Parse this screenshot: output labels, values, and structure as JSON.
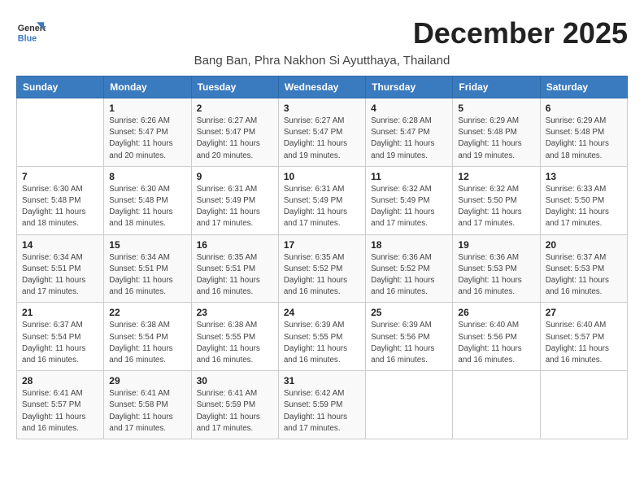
{
  "header": {
    "logo_line1": "General",
    "logo_line2": "Blue",
    "month_title": "December 2025",
    "location": "Bang Ban, Phra Nakhon Si Ayutthaya, Thailand"
  },
  "weekdays": [
    "Sunday",
    "Monday",
    "Tuesday",
    "Wednesday",
    "Thursday",
    "Friday",
    "Saturday"
  ],
  "weeks": [
    [
      {
        "day": "",
        "sunrise": "",
        "sunset": "",
        "daylight": ""
      },
      {
        "day": "1",
        "sunrise": "Sunrise: 6:26 AM",
        "sunset": "Sunset: 5:47 PM",
        "daylight": "Daylight: 11 hours and 20 minutes."
      },
      {
        "day": "2",
        "sunrise": "Sunrise: 6:27 AM",
        "sunset": "Sunset: 5:47 PM",
        "daylight": "Daylight: 11 hours and 20 minutes."
      },
      {
        "day": "3",
        "sunrise": "Sunrise: 6:27 AM",
        "sunset": "Sunset: 5:47 PM",
        "daylight": "Daylight: 11 hours and 19 minutes."
      },
      {
        "day": "4",
        "sunrise": "Sunrise: 6:28 AM",
        "sunset": "Sunset: 5:47 PM",
        "daylight": "Daylight: 11 hours and 19 minutes."
      },
      {
        "day": "5",
        "sunrise": "Sunrise: 6:29 AM",
        "sunset": "Sunset: 5:48 PM",
        "daylight": "Daylight: 11 hours and 19 minutes."
      },
      {
        "day": "6",
        "sunrise": "Sunrise: 6:29 AM",
        "sunset": "Sunset: 5:48 PM",
        "daylight": "Daylight: 11 hours and 18 minutes."
      }
    ],
    [
      {
        "day": "7",
        "sunrise": "Sunrise: 6:30 AM",
        "sunset": "Sunset: 5:48 PM",
        "daylight": "Daylight: 11 hours and 18 minutes."
      },
      {
        "day": "8",
        "sunrise": "Sunrise: 6:30 AM",
        "sunset": "Sunset: 5:48 PM",
        "daylight": "Daylight: 11 hours and 18 minutes."
      },
      {
        "day": "9",
        "sunrise": "Sunrise: 6:31 AM",
        "sunset": "Sunset: 5:49 PM",
        "daylight": "Daylight: 11 hours and 17 minutes."
      },
      {
        "day": "10",
        "sunrise": "Sunrise: 6:31 AM",
        "sunset": "Sunset: 5:49 PM",
        "daylight": "Daylight: 11 hours and 17 minutes."
      },
      {
        "day": "11",
        "sunrise": "Sunrise: 6:32 AM",
        "sunset": "Sunset: 5:49 PM",
        "daylight": "Daylight: 11 hours and 17 minutes."
      },
      {
        "day": "12",
        "sunrise": "Sunrise: 6:32 AM",
        "sunset": "Sunset: 5:50 PM",
        "daylight": "Daylight: 11 hours and 17 minutes."
      },
      {
        "day": "13",
        "sunrise": "Sunrise: 6:33 AM",
        "sunset": "Sunset: 5:50 PM",
        "daylight": "Daylight: 11 hours and 17 minutes."
      }
    ],
    [
      {
        "day": "14",
        "sunrise": "Sunrise: 6:34 AM",
        "sunset": "Sunset: 5:51 PM",
        "daylight": "Daylight: 11 hours and 17 minutes."
      },
      {
        "day": "15",
        "sunrise": "Sunrise: 6:34 AM",
        "sunset": "Sunset: 5:51 PM",
        "daylight": "Daylight: 11 hours and 16 minutes."
      },
      {
        "day": "16",
        "sunrise": "Sunrise: 6:35 AM",
        "sunset": "Sunset: 5:51 PM",
        "daylight": "Daylight: 11 hours and 16 minutes."
      },
      {
        "day": "17",
        "sunrise": "Sunrise: 6:35 AM",
        "sunset": "Sunset: 5:52 PM",
        "daylight": "Daylight: 11 hours and 16 minutes."
      },
      {
        "day": "18",
        "sunrise": "Sunrise: 6:36 AM",
        "sunset": "Sunset: 5:52 PM",
        "daylight": "Daylight: 11 hours and 16 minutes."
      },
      {
        "day": "19",
        "sunrise": "Sunrise: 6:36 AM",
        "sunset": "Sunset: 5:53 PM",
        "daylight": "Daylight: 11 hours and 16 minutes."
      },
      {
        "day": "20",
        "sunrise": "Sunrise: 6:37 AM",
        "sunset": "Sunset: 5:53 PM",
        "daylight": "Daylight: 11 hours and 16 minutes."
      }
    ],
    [
      {
        "day": "21",
        "sunrise": "Sunrise: 6:37 AM",
        "sunset": "Sunset: 5:54 PM",
        "daylight": "Daylight: 11 hours and 16 minutes."
      },
      {
        "day": "22",
        "sunrise": "Sunrise: 6:38 AM",
        "sunset": "Sunset: 5:54 PM",
        "daylight": "Daylight: 11 hours and 16 minutes."
      },
      {
        "day": "23",
        "sunrise": "Sunrise: 6:38 AM",
        "sunset": "Sunset: 5:55 PM",
        "daylight": "Daylight: 11 hours and 16 minutes."
      },
      {
        "day": "24",
        "sunrise": "Sunrise: 6:39 AM",
        "sunset": "Sunset: 5:55 PM",
        "daylight": "Daylight: 11 hours and 16 minutes."
      },
      {
        "day": "25",
        "sunrise": "Sunrise: 6:39 AM",
        "sunset": "Sunset: 5:56 PM",
        "daylight": "Daylight: 11 hours and 16 minutes."
      },
      {
        "day": "26",
        "sunrise": "Sunrise: 6:40 AM",
        "sunset": "Sunset: 5:56 PM",
        "daylight": "Daylight: 11 hours and 16 minutes."
      },
      {
        "day": "27",
        "sunrise": "Sunrise: 6:40 AM",
        "sunset": "Sunset: 5:57 PM",
        "daylight": "Daylight: 11 hours and 16 minutes."
      }
    ],
    [
      {
        "day": "28",
        "sunrise": "Sunrise: 6:41 AM",
        "sunset": "Sunset: 5:57 PM",
        "daylight": "Daylight: 11 hours and 16 minutes."
      },
      {
        "day": "29",
        "sunrise": "Sunrise: 6:41 AM",
        "sunset": "Sunset: 5:58 PM",
        "daylight": "Daylight: 11 hours and 17 minutes."
      },
      {
        "day": "30",
        "sunrise": "Sunrise: 6:41 AM",
        "sunset": "Sunset: 5:59 PM",
        "daylight": "Daylight: 11 hours and 17 minutes."
      },
      {
        "day": "31",
        "sunrise": "Sunrise: 6:42 AM",
        "sunset": "Sunset: 5:59 PM",
        "daylight": "Daylight: 11 hours and 17 minutes."
      },
      {
        "day": "",
        "sunrise": "",
        "sunset": "",
        "daylight": ""
      },
      {
        "day": "",
        "sunrise": "",
        "sunset": "",
        "daylight": ""
      },
      {
        "day": "",
        "sunrise": "",
        "sunset": "",
        "daylight": ""
      }
    ]
  ]
}
